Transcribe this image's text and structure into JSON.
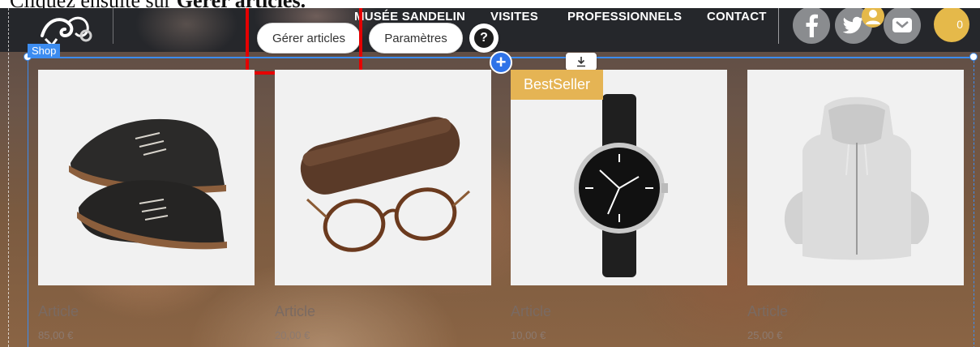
{
  "caption": {
    "prefix": "Cliquez ensuite sur ",
    "emphasis": "Gérer articles."
  },
  "nav": {
    "items": [
      "MUSÉE SANDELIN",
      "VISITES",
      "PROFESSIONNELS",
      "CONTACT"
    ],
    "cart_count": "0"
  },
  "editor": {
    "manage_label": "Gérer articles",
    "settings_label": "Paramètres",
    "help_label": "?",
    "shop_tag": "Shop",
    "add_label": "+"
  },
  "products": [
    {
      "name": "Article",
      "price": "85,00 €",
      "image": "boots-photo"
    },
    {
      "name": "Article",
      "price": "20,00 €",
      "image": "glasses-case-photo"
    },
    {
      "name": "Article",
      "price": "10,00 €",
      "image": "watch-photo",
      "badge": "BestSeller"
    },
    {
      "name": "Article",
      "price": "25,00 €",
      "image": "hoodie-photo"
    }
  ],
  "colors": {
    "accent": "#3c8cf0",
    "badge": "#e5b454",
    "highlight": "#e50000"
  }
}
